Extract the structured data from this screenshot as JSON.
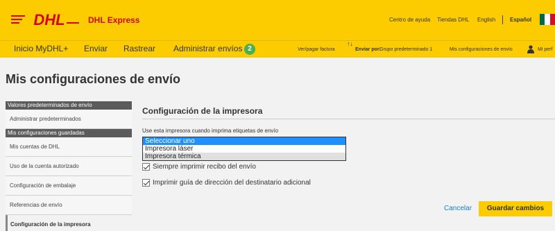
{
  "header": {
    "logo_text": "DHL",
    "brand": "DHL Express",
    "links": [
      "Centro de ayuda",
      "Tiendas DHL",
      "English",
      "Español"
    ],
    "flag_colors": [
      "#006847",
      "#ffffff",
      "#ce1126"
    ]
  },
  "nav": {
    "items": [
      "Inicio MyDHL+",
      "Enviar",
      "Rastrear",
      "Administrar envíos"
    ],
    "badge": "2",
    "pay_invoice": "Ver/pagar factura",
    "ship_by_label": "Enviar por:",
    "ship_by_value": "Grupo predeterminado 1",
    "settings": "Mis configuraciones de envío",
    "profile": "Mi perf"
  },
  "page": {
    "title": "Mis configuraciones de envío"
  },
  "sidebar": {
    "section1": "Valores predeterminados de envío",
    "section1_items": [
      "Administrar predeterminados"
    ],
    "section2": "Mis configuraciones guardadas",
    "section2_items": [
      "Mis cuentas de DHL",
      "Uso de la cuenta autorizado",
      "Configuración de embalaje",
      "Referencias de envío"
    ],
    "active_item": "Configuración de la impresora"
  },
  "main": {
    "section_title": "Configuración de la impresora",
    "printer_label": "Use esta impresora cuando imprima etiquetas de envío",
    "printer_options": [
      "Seleccionar uno",
      "Impresora láser",
      "Impresora térmica"
    ],
    "checkbox1_label": "Siempre imprimir recibo del envío",
    "checkbox1_checked": true,
    "checkbox2_label": "Imprimir guía de dirección del destinatario adicional",
    "checkbox2_checked": true,
    "cancel_label": "Cancelar",
    "save_label": "Guardar cambios"
  }
}
